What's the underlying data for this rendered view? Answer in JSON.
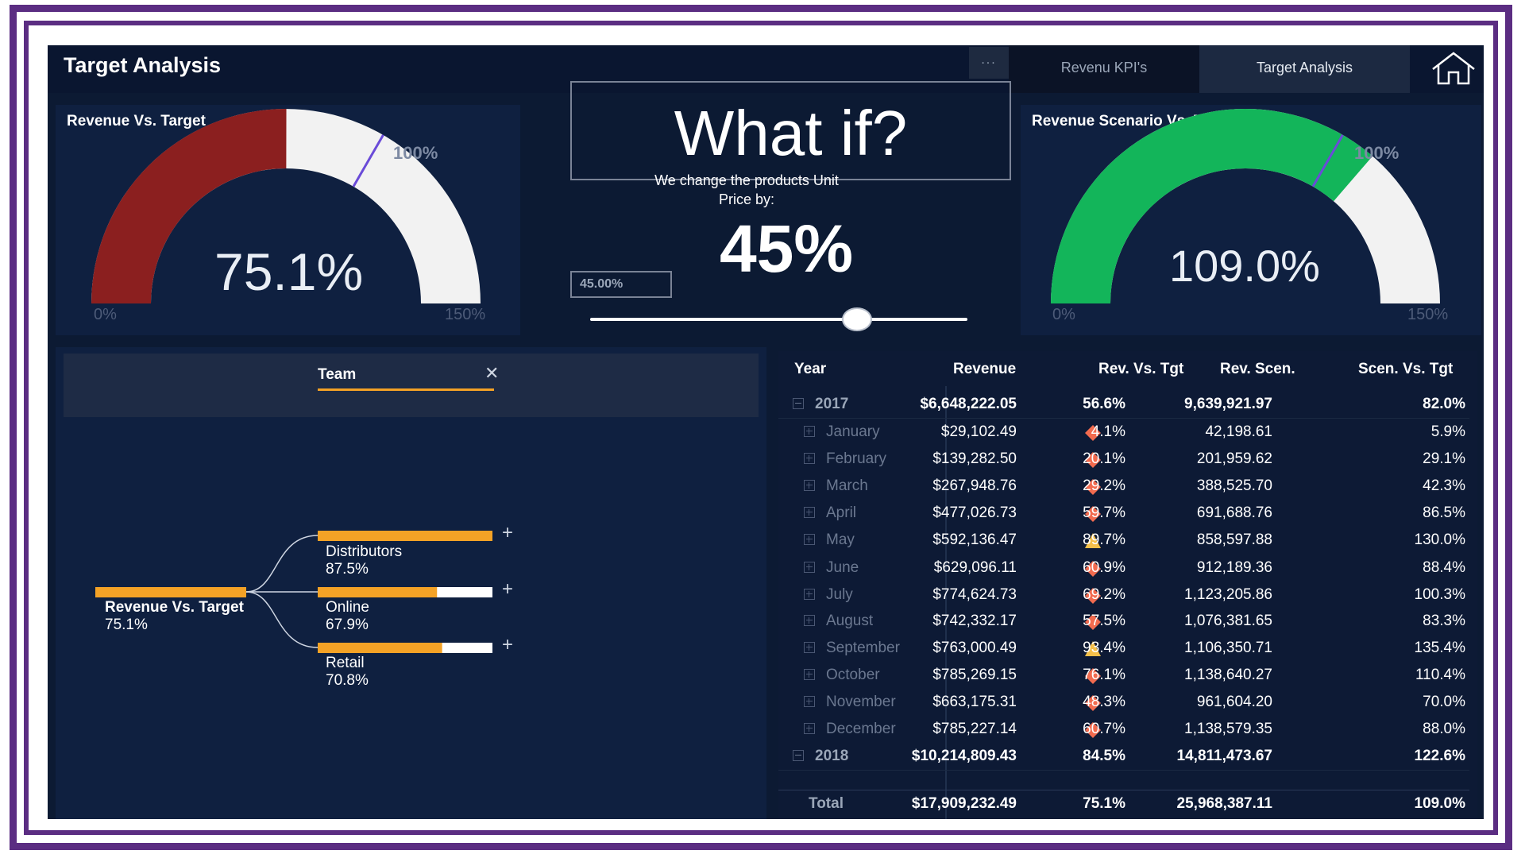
{
  "header": {
    "title": "Target Analysis",
    "more_label": "...",
    "tabs": [
      {
        "label": "Revenu KPI's",
        "active": false
      },
      {
        "label": "Target Analysis",
        "active": true
      }
    ],
    "home_icon": "home-icon"
  },
  "gauge_left": {
    "title": "Revenue Vs. Target",
    "value_label": "75.1%",
    "value": 75.1,
    "target_label": "100%",
    "target": 100,
    "min_label": "0%",
    "max_label": "150%",
    "min": 0,
    "max": 150,
    "fill_color": "#8b1f1f",
    "track_color": "#f2f2f2",
    "target_color": "#6a4bd8"
  },
  "what_if": {
    "title": "What if?",
    "subtitle_line1": "We change the products Unit",
    "subtitle_line2": "Price by:",
    "big_value": "45%",
    "input_value": "45.00%",
    "slider_value": 45
  },
  "gauge_right": {
    "title": "Revenue Scenario Vs. Target",
    "value_label": "109.0%",
    "value": 109.0,
    "target_label": "100%",
    "target": 100,
    "min_label": "0%",
    "max_label": "150%",
    "min": 0,
    "max": 150,
    "fill_color": "#13b55a",
    "track_color": "#f2f2f2",
    "target_color": "#6a4bd8"
  },
  "decomp": {
    "filter_label": "Team",
    "close_icon": "close-icon",
    "root": {
      "name": "Revenue Vs. Target",
      "value_label": "75.1%",
      "value": 75.1
    },
    "children": [
      {
        "name": "Distributors",
        "value_label": "87.5%",
        "value": 87.5
      },
      {
        "name": "Online",
        "value_label": "67.9%",
        "value": 67.9
      },
      {
        "name": "Retail",
        "value_label": "70.8%",
        "value": 70.8
      }
    ],
    "expand_symbol": "+",
    "bar_color": "#f4a226"
  },
  "table": {
    "columns": [
      "Year",
      "Revenue",
      "Rev. Vs. Tgt",
      "Rev. Scen.",
      "Scen. Vs. Tgt"
    ],
    "rows": [
      {
        "label": "2017",
        "level": 0,
        "revenue": "$6,648,222.05",
        "rev_vs_tgt": "56.6%",
        "rev_scen": "9,639,921.97",
        "scen_vs_tgt": "82.0%",
        "indicator": ""
      },
      {
        "label": "January",
        "level": 1,
        "revenue": "$29,102.49",
        "rev_vs_tgt": "4.1%",
        "rev_scen": "42,198.61",
        "scen_vs_tgt": "5.9%",
        "indicator": "diamond"
      },
      {
        "label": "February",
        "level": 1,
        "revenue": "$139,282.50",
        "rev_vs_tgt": "20.1%",
        "rev_scen": "201,959.62",
        "scen_vs_tgt": "29.1%",
        "indicator": "diamond"
      },
      {
        "label": "March",
        "level": 1,
        "revenue": "$267,948.76",
        "rev_vs_tgt": "29.2%",
        "rev_scen": "388,525.70",
        "scen_vs_tgt": "42.3%",
        "indicator": "diamond"
      },
      {
        "label": "April",
        "level": 1,
        "revenue": "$477,026.73",
        "rev_vs_tgt": "59.7%",
        "rev_scen": "691,688.76",
        "scen_vs_tgt": "86.5%",
        "indicator": "diamond"
      },
      {
        "label": "May",
        "level": 1,
        "revenue": "$592,136.47",
        "rev_vs_tgt": "89.7%",
        "rev_scen": "858,597.88",
        "scen_vs_tgt": "130.0%",
        "indicator": "triangle"
      },
      {
        "label": "June",
        "level": 1,
        "revenue": "$629,096.11",
        "rev_vs_tgt": "60.9%",
        "rev_scen": "912,189.36",
        "scen_vs_tgt": "88.4%",
        "indicator": "diamond"
      },
      {
        "label": "July",
        "level": 1,
        "revenue": "$774,624.73",
        "rev_vs_tgt": "69.2%",
        "rev_scen": "1,123,205.86",
        "scen_vs_tgt": "100.3%",
        "indicator": "diamond"
      },
      {
        "label": "August",
        "level": 1,
        "revenue": "$742,332.17",
        "rev_vs_tgt": "57.5%",
        "rev_scen": "1,076,381.65",
        "scen_vs_tgt": "83.3%",
        "indicator": "diamond"
      },
      {
        "label": "September",
        "level": 1,
        "revenue": "$763,000.49",
        "rev_vs_tgt": "93.4%",
        "rev_scen": "1,106,350.71",
        "scen_vs_tgt": "135.4%",
        "indicator": "triangle"
      },
      {
        "label": "October",
        "level": 1,
        "revenue": "$785,269.15",
        "rev_vs_tgt": "76.1%",
        "rev_scen": "1,138,640.27",
        "scen_vs_tgt": "110.4%",
        "indicator": "diamond"
      },
      {
        "label": "November",
        "level": 1,
        "revenue": "$663,175.31",
        "rev_vs_tgt": "48.3%",
        "rev_scen": "961,604.20",
        "scen_vs_tgt": "70.0%",
        "indicator": "diamond"
      },
      {
        "label": "December",
        "level": 1,
        "revenue": "$785,227.14",
        "rev_vs_tgt": "60.7%",
        "rev_scen": "1,138,579.35",
        "scen_vs_tgt": "88.0%",
        "indicator": "diamond"
      },
      {
        "label": "2018",
        "level": 0,
        "revenue": "$10,214,809.43",
        "rev_vs_tgt": "84.5%",
        "rev_scen": "14,811,473.67",
        "scen_vs_tgt": "122.6%",
        "indicator": ""
      }
    ],
    "total": {
      "label": "Total",
      "revenue": "$17,909,232.49",
      "rev_vs_tgt": "75.1%",
      "rev_scen": "25,968,387.11",
      "scen_vs_tgt": "109.0%"
    },
    "indicator_colors": {
      "diamond": "#f26b4f",
      "triangle": "#f5c04a",
      "circle": "#3cba6a"
    }
  }
}
